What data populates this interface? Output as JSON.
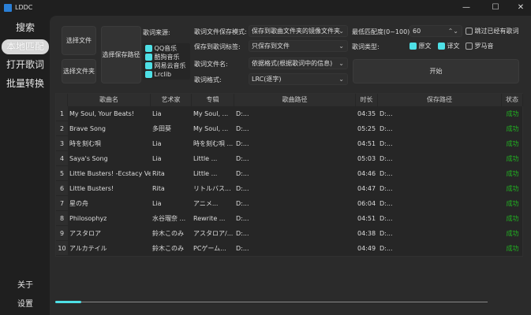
{
  "window": {
    "title": "LDDC",
    "controls": [
      "minimize",
      "maximize",
      "close"
    ]
  },
  "sidebar": {
    "items": [
      {
        "label": "搜索"
      },
      {
        "label": "本地匹配",
        "active": true
      },
      {
        "label": "打开歌词"
      },
      {
        "label": "批量转换"
      }
    ],
    "bottom": [
      {
        "label": "关于"
      },
      {
        "label": "设置"
      }
    ]
  },
  "controls": {
    "select_file": "选择文件",
    "select_folder": "选择文件夹",
    "select_save_path": "选择保存路径",
    "source_label": "歌词来源:",
    "sources": [
      {
        "label": "QQ音乐",
        "checked": true
      },
      {
        "label": "酷狗音乐",
        "checked": true
      },
      {
        "label": "网易云音乐",
        "checked": true
      },
      {
        "label": "Lrclib",
        "checked": true
      }
    ],
    "save_mode_label": "歌词文件保存模式:",
    "save_mode_value": "保存到歌曲文件夹的镜像文件夹",
    "save_tag_label": "保存到歌词标签:",
    "save_tag_value": "只保存到文件",
    "filename_label": "歌词文件名:",
    "filename_value": "依据格式(根据歌词中的信息)",
    "format_label": "歌词格式:",
    "format_value": "LRC(逐字)",
    "min_score_label": "最低匹配度(0~100):",
    "min_score_value": "60",
    "skip_existing_label": "跳过已经有歌词",
    "skip_existing_checked": false,
    "lyric_type_label": "歌词类型:",
    "lyric_types": [
      {
        "label": "原文",
        "checked": true
      },
      {
        "label": "译文",
        "checked": true
      },
      {
        "label": "罗马音",
        "checked": false
      }
    ],
    "start": "开始"
  },
  "table": {
    "columns": [
      "歌曲名",
      "艺术家",
      "专辑",
      "歌曲路径",
      "时长",
      "保存路径",
      "状态"
    ],
    "rows": [
      [
        "1",
        "My Soul, Your Beats!",
        "Lia",
        "My Soul, ...",
        "D:...",
        "04:35",
        "D:...",
        "成功"
      ],
      [
        "2",
        "Brave Song",
        "多田葵",
        "My Soul, ...",
        "D:...",
        "05:25",
        "D:...",
        "成功"
      ],
      [
        "3",
        "時を刻む唄",
        "Lia",
        "時を刻む唄 ...",
        "D:...",
        "04:51",
        "D:...",
        "成功"
      ],
      [
        "4",
        "Saya's Song",
        "Lia",
        "Little ...",
        "D:...",
        "05:03",
        "D:...",
        "成功"
      ],
      [
        "5",
        "Little Busters! -Ecstacy Ver.-",
        "Rita",
        "Little ...",
        "D:...",
        "04:46",
        "D:...",
        "成功"
      ],
      [
        "6",
        "Little Busters!",
        "Rita",
        "リトルバス...",
        "D:...",
        "04:47",
        "D:...",
        "成功"
      ],
      [
        "7",
        "星の舟",
        "Lia",
        "アニメ...",
        "D:...",
        "06:04",
        "D:...",
        "成功"
      ],
      [
        "8",
        "Philosophyz",
        "水谷瑠奈 ...",
        "Rewrite ...",
        "D:...",
        "04:51",
        "D:...",
        "成功"
      ],
      [
        "9",
        "アスタロア",
        "鈴木このみ",
        "アスタロア/...",
        "D:...",
        "04:38",
        "D:...",
        "成功"
      ],
      [
        "10",
        "アルカテイル",
        "鈴木このみ",
        "PCゲーム...",
        "D:...",
        "04:49",
        "D:...",
        "成功"
      ]
    ]
  },
  "progress": {
    "percent": 6,
    "color": "#4ee0e6"
  },
  "colors": {
    "accent": "#4ee0e6",
    "success": "#21b321"
  }
}
